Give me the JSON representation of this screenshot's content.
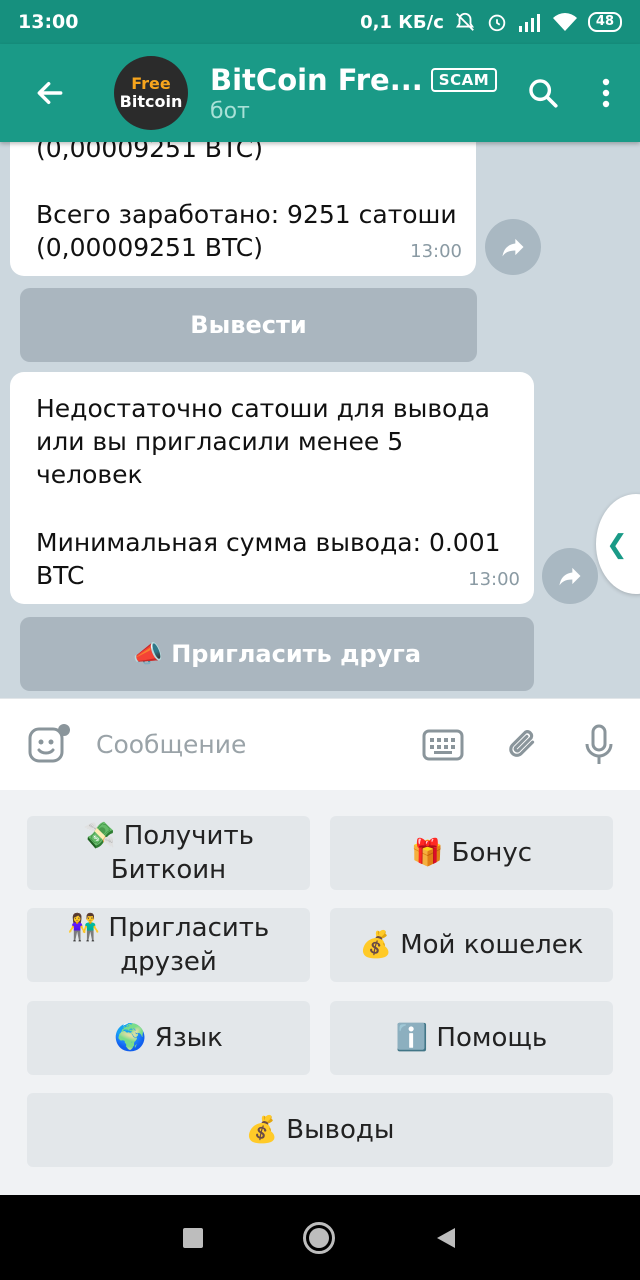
{
  "status_bar": {
    "time": "13:00",
    "speed": "0,1 КБ/с",
    "battery": "48"
  },
  "header": {
    "avatar_line1": "Free",
    "avatar_line2": "Bitcoin",
    "title": "BitCoin Fre...",
    "badge": "SCAM",
    "subtitle": "бот"
  },
  "messages": [
    {
      "partial_line": "(0,00009251 BTC)",
      "line1": "Всего заработано: 9251 сатоши",
      "line2": "(0,00009251 BTC)",
      "time": "13:00"
    },
    {
      "line1": "Недостаточно сатоши для вывода",
      "line2": "или вы пригласили менее 5",
      "line3": "человек",
      "line4": "Минимальная сумма вывода: 0.001",
      "line5": "BTC",
      "time": "13:00"
    }
  ],
  "inline_buttons": {
    "withdraw": "Вывести",
    "invite_friend": "📣 Пригласить друга"
  },
  "input": {
    "placeholder": "Сообщение"
  },
  "keyboard": {
    "get_bitcoin_1": "💸 Получить",
    "get_bitcoin_2": "Биткоин",
    "bonus": "🎁 Бонус",
    "invite_1": "👫 Пригласить",
    "invite_2": "друзей",
    "wallet": "💰 Мой кошелек",
    "language": "🌍 Язык",
    "help": "ℹ️ Помощь",
    "withdrawals": "💰 Выводы"
  },
  "colors": {
    "header": "#1a9a87",
    "status_bar": "#16907e",
    "chat_bg": "#ccd7de"
  }
}
